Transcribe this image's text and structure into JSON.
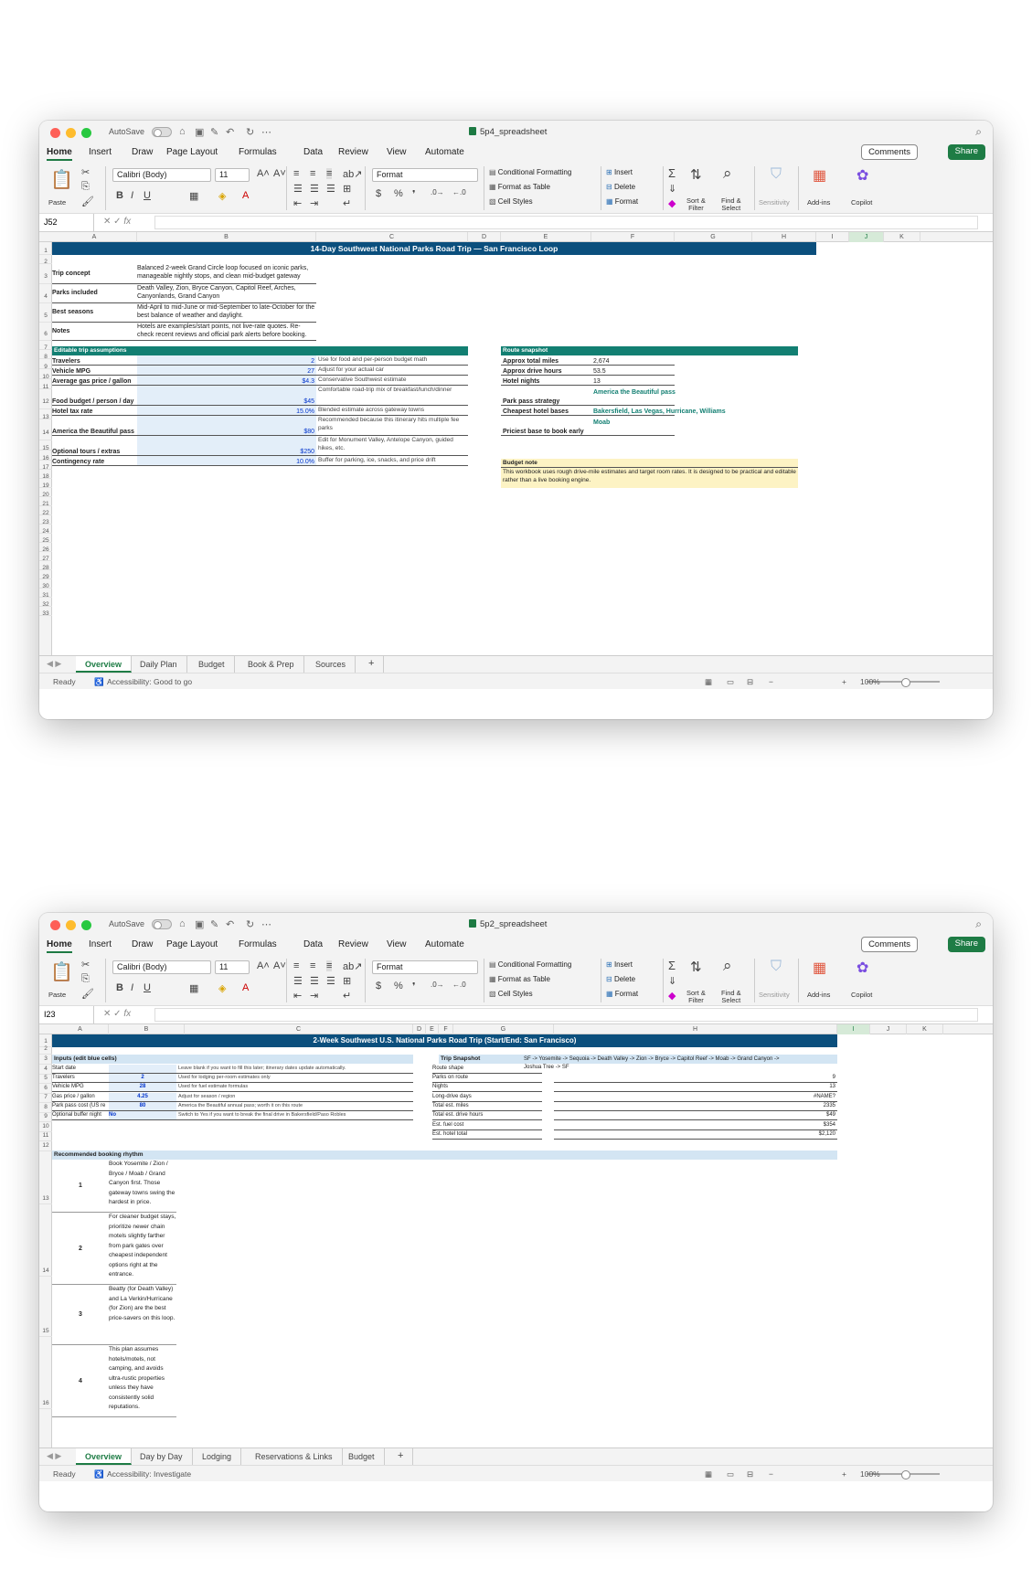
{
  "windows": [
    {
      "autosave": "AutoSave",
      "filename": "5p4_spreadsheet",
      "menu": [
        "Home",
        "Insert",
        "Draw",
        "Page Layout",
        "Formulas",
        "Data",
        "Review",
        "View",
        "Automate"
      ],
      "comments": "Comments",
      "share": "Share",
      "ribbon": {
        "paste": "Paste",
        "font": "Calibri (Body)",
        "size": "11",
        "format": "Format",
        "cond": "Conditional Formatting",
        "fmt_table": "Format as Table",
        "cell_styles": "Cell Styles",
        "insert": "Insert",
        "delete": "Delete",
        "sort": "Sort &\nFilter",
        "find": "Find &\nSelect",
        "sensitivity": "Sensitivity",
        "addins": "Add-ins",
        "copilot": "Copilot"
      },
      "namebox": "J52",
      "columns": [
        "A",
        "B",
        "C",
        "D",
        "E",
        "F",
        "G",
        "H",
        "I",
        "J",
        "K"
      ],
      "title": "14-Day Southwest National Parks Road Trip — San Francisco Loop",
      "concept": [
        {
          "label": "Trip concept",
          "value": "Balanced 2-week Grand Circle loop focused on iconic parks, manageable nightly stops, and clean mid-budget gateway"
        },
        {
          "label": "Parks included",
          "value": "Death Valley, Zion, Bryce Canyon, Capitol Reef, Arches, Canyonlands, Grand Canyon"
        },
        {
          "label": "Best seasons",
          "value": "Mid-April to mid-June or mid-September to late-October for the best balance of weather and daylight."
        },
        {
          "label": "Notes",
          "value": "Hotels are examples/start points, not live-rate quotes. Re-check recent reviews and official park alerts before booking."
        }
      ],
      "assump_header": "Editable trip assumptions",
      "assumptions": [
        {
          "label": "Travelers",
          "value": "2",
          "note": "Use for food and per-person budget math"
        },
        {
          "label": "Vehicle MPG",
          "value": "27",
          "note": "Adjust for your actual car"
        },
        {
          "label": "Average gas price / gallon",
          "value": "$4.3",
          "note": "Conservative Southwest estimate"
        },
        {
          "label": "Food budget / person / day",
          "value": "$45",
          "note": "Comfortable road-trip mix of breakfast/lunch/dinner"
        },
        {
          "label": "Hotel tax rate",
          "value": "15.0%",
          "note": "Blended estimate across gateway towns"
        },
        {
          "label": "America the Beautiful pass",
          "value": "$80",
          "note": "Recommended because this itinerary hits multiple fee parks"
        },
        {
          "label": "Optional tours / extras",
          "value": "$250",
          "note": "Edit for Monument Valley, Antelope Canyon, guided hikes, etc."
        },
        {
          "label": "Contingency rate",
          "value": "10.0%",
          "note": "Buffer for parking, ice, snacks, and price drift"
        }
      ],
      "route_header": "Route snapshot",
      "route": [
        {
          "label": "Approx total miles",
          "value": "2,674"
        },
        {
          "label": "Approx drive hours",
          "value": "53.5"
        },
        {
          "label": "Hotel nights",
          "value": "13"
        },
        {
          "label": "Park pass strategy",
          "value": "America the Beautiful pass"
        },
        {
          "label": "Cheapest hotel bases",
          "value": "Bakersfield, Las Vegas, Hurricane, Williams"
        },
        {
          "label": "Priciest base to book early",
          "value": "Moab"
        }
      ],
      "budget_note_header": "Budget note",
      "budget_note": "This workbook uses rough drive-mile estimates and target room rates. It is designed to be practical and editable rather than a live booking engine.",
      "tabs": [
        "Overview",
        "Daily Plan",
        "Budget",
        "Book & Prep",
        "Sources"
      ],
      "status": "Ready",
      "accessibility": "Accessibility: Good to go",
      "zoom": "100%"
    },
    {
      "autosave": "AutoSave",
      "filename": "5p2_spreadsheet",
      "menu": [
        "Home",
        "Insert",
        "Draw",
        "Page Layout",
        "Formulas",
        "Data",
        "Review",
        "View",
        "Automate"
      ],
      "comments": "Comments",
      "share": "Share",
      "namebox": "I23",
      "columns": [
        "A",
        "B",
        "C",
        "D",
        "E",
        "F",
        "G",
        "H",
        "I",
        "J",
        "K"
      ],
      "title": "2-Week Southwest U.S. National Parks Road Trip (Start/End: San Francisco)",
      "inputs_header": "Inputs (edit blue cells)",
      "inputs": [
        {
          "label": "Start date",
          "value": "",
          "note": "Leave blank if you want to fill this later; itinerary dates update automatically."
        },
        {
          "label": "Travelers",
          "value": "2",
          "note": "Used for lodging per-room estimates only"
        },
        {
          "label": "Vehicle MPG",
          "value": "28",
          "note": "Used for fuel estimate formulas"
        },
        {
          "label": "Gas price / gallon",
          "value": "4.25",
          "note": "Adjust for season / region"
        },
        {
          "label": "Park pass cost (US re",
          "value": "80",
          "note": "America the Beautiful annual pass; worth it on this route"
        },
        {
          "label": "Optional buffer night",
          "value": "No",
          "note": "Switch to Yes if you want to break the final drive in Bakersfield/Paso Robles"
        }
      ],
      "snapshot_header": "Trip Snapshot",
      "snapshot": [
        {
          "label": "Route shape",
          "value": "SF -> Yosemite -> Sequoia -> Death Valley -> Zion -> Bryce -> Capitol Reef -> Moab -> Grand Canyon -> Joshua Tree -> SF"
        },
        {
          "label": "Parks on route",
          "value": "9"
        },
        {
          "label": "Nights",
          "value": "13"
        },
        {
          "label": "Long-drive days",
          "value": "#NAME?"
        },
        {
          "label": "Total est. miles",
          "value": "2335"
        },
        {
          "label": "Total est. drive hours",
          "value": "$49"
        },
        {
          "label": "Est. fuel cost",
          "value": "$354"
        },
        {
          "label": "Est. hotel total",
          "value": "$2,120"
        }
      ],
      "rhythm_header": "Recommended booking rhythm",
      "rhythm": [
        {
          "n": "1",
          "text": "Book Yosemite / Zion / Bryce / Moab / Grand Canyon first. Those gateway towns swing the hardest in price."
        },
        {
          "n": "2",
          "text": "For cleaner budget stays, prioritize newer chain motels slightly farther from park gates over cheapest independent options right at the entrance."
        },
        {
          "n": "3",
          "text": "Beatty (for Death Valley) and La Verkin/Hurricane (for Zion) are the best price-savers on this loop."
        },
        {
          "n": "4",
          "text": "This plan assumes hotels/motels, not camping, and avoids ultra-rustic properties unless they have consistently solid reputations."
        }
      ],
      "tabs": [
        "Overview",
        "Day by Day",
        "Lodging",
        "Reservations & Links",
        "Budget"
      ],
      "status": "Ready",
      "accessibility": "Accessibility: Investigate",
      "zoom": "100%"
    }
  ]
}
